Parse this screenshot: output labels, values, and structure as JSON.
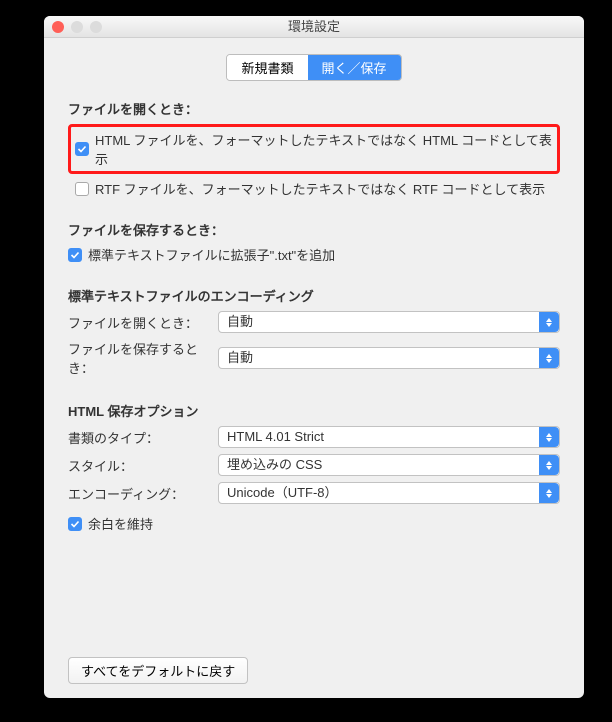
{
  "window": {
    "title": "環境設定"
  },
  "tabs": {
    "new_doc": "新規書類",
    "open_save": "開く／保存"
  },
  "open": {
    "section": "ファイルを開くとき：",
    "html_as_code": "HTML ファイルを、フォーマットしたテキストではなく HTML コードとして表示",
    "rtf_as_code": "RTF ファイルを、フォーマットしたテキストではなく RTF コードとして表示"
  },
  "save": {
    "section": "ファイルを保存するとき：",
    "add_txt": "標準テキストファイルに拡張子\".txt\"を追加"
  },
  "encoding": {
    "section": "標準テキストファイルのエンコーディング",
    "open_label": "ファイルを開くとき：",
    "open_value": "自動",
    "save_label": "ファイルを保存するとき：",
    "save_value": "自動"
  },
  "html": {
    "section": "HTML 保存オプション",
    "doctype_label": "書類のタイプ：",
    "doctype_value": "HTML 4.01 Strict",
    "style_label": "スタイル：",
    "style_value": "埋め込みの CSS",
    "encoding_label": "エンコーディング：",
    "encoding_value": "Unicode（UTF-8）",
    "preserve_ws": "余白を維持"
  },
  "reset": "すべてをデフォルトに戻す"
}
